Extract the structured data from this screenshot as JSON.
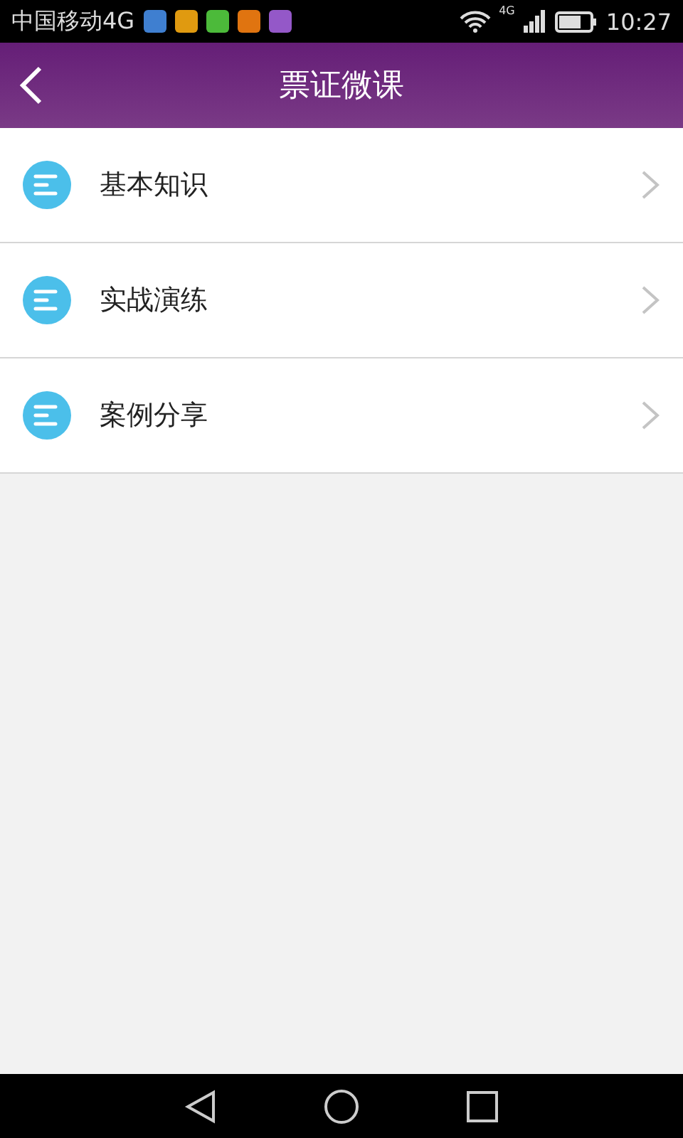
{
  "status_bar": {
    "carrier": "中国移动4G",
    "network_badge": "4G",
    "time": "10:27",
    "notifications": [
      {
        "color": "#3f7fd0"
      },
      {
        "color": "#e09a10"
      },
      {
        "color": "#4cba3a"
      },
      {
        "color": "#e07410"
      },
      {
        "color": "#9458c8"
      }
    ]
  },
  "header": {
    "back": true,
    "title": "票证微课"
  },
  "menu": [
    {
      "label": "基本知识"
    },
    {
      "label": "实战演练"
    },
    {
      "label": "案例分享"
    }
  ]
}
